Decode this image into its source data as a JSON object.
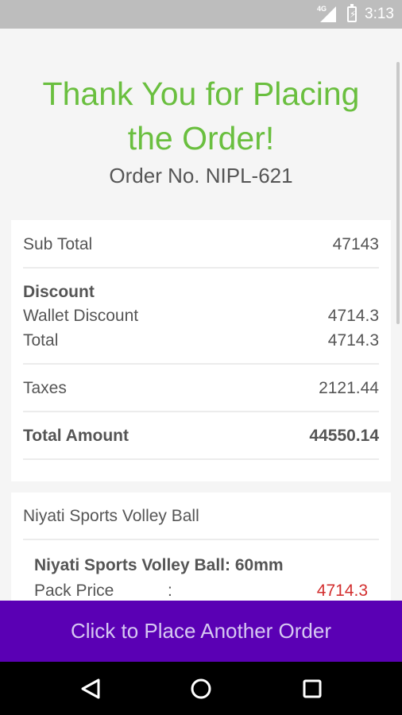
{
  "status_bar": {
    "network": "4G",
    "time": "3:13"
  },
  "header": {
    "thanks_line1": "Thank You for Placing",
    "thanks_line2": "the Order!",
    "order_number": "Order No. NIPL-621"
  },
  "summary": {
    "sub_total_label": "Sub Total",
    "sub_total_value": "47143",
    "discount_heading": "Discount",
    "wallet_discount_label": "Wallet Discount",
    "wallet_discount_value": "4714.3",
    "discount_total_label": "Total",
    "discount_total_value": "4714.3",
    "taxes_label": "Taxes",
    "taxes_value": "2121.44",
    "total_amount_label": "Total Amount",
    "total_amount_value": "44550.14"
  },
  "product": {
    "name": "Niyati Sports Volley Ball",
    "variant": "Niyati Sports Volley Ball: 60mm",
    "pack_price_label": "Pack Price",
    "pack_price_separator": ":",
    "pack_price_value": "4714.3"
  },
  "cta": {
    "label": "Click to Place Another Order"
  },
  "nav": {
    "back_icon": "back-icon",
    "home_icon": "home-icon",
    "recents_icon": "recents-icon"
  },
  "colors": {
    "accent_green": "#6abf3f",
    "button_purple": "#5a00b4",
    "price_red": "#d32f2f"
  }
}
